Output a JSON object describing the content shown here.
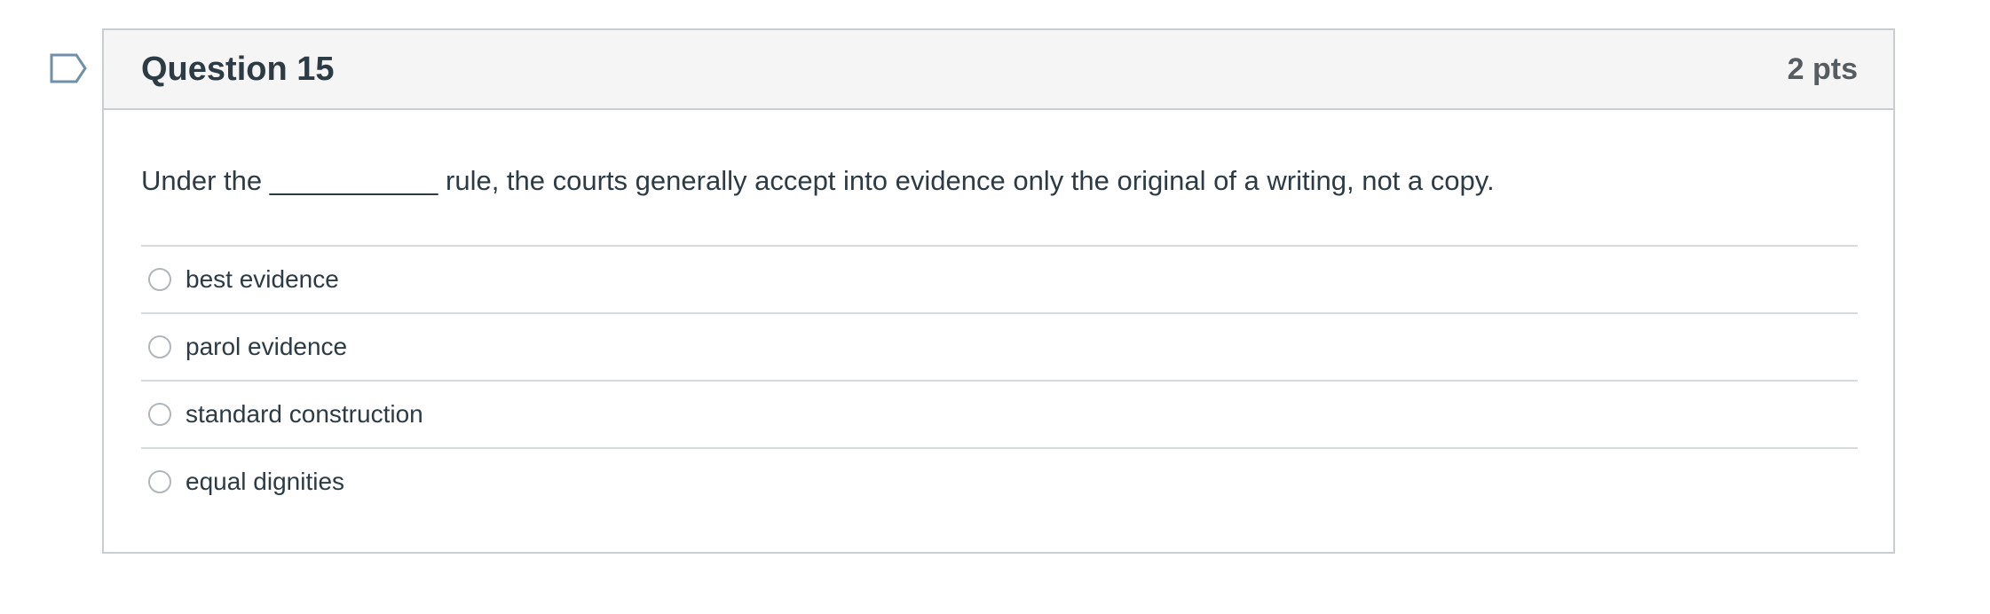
{
  "question": {
    "title": "Question 15",
    "points": "2 pts",
    "text": "Under the ___________ rule, the courts generally accept into evidence only the original of a writing, not a copy.",
    "answers": [
      {
        "label": "best evidence"
      },
      {
        "label": "parol evidence"
      },
      {
        "label": "standard construction"
      },
      {
        "label": "equal dignities"
      }
    ]
  },
  "flag": {
    "icon": "flag-icon",
    "color": "#6f90a8"
  },
  "colors": {
    "header_bg": "#f5f5f5",
    "border": "#c7cdd1",
    "text": "#2d3b45",
    "points_text": "#575c61"
  }
}
